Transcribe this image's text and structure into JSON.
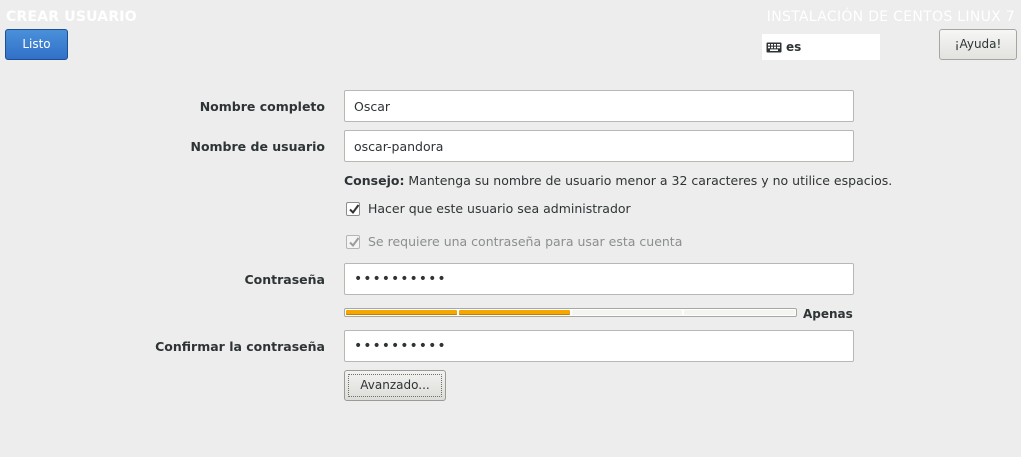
{
  "header": {
    "title": "CREAR USUARIO",
    "install_title": "INSTALACIÓN DE CENTOS LINUX 7",
    "done_label": "Listo",
    "help_label": "¡Ayuda!",
    "keyboard_layout": "es",
    "keyboard_icon": "keyboard-icon"
  },
  "form": {
    "fullname": {
      "label": "Nombre completo",
      "value": "Oscar"
    },
    "username": {
      "label": "Nombre de usuario",
      "value": "oscar-pandora"
    },
    "hint": {
      "prefix": "Consejo:",
      "text": " Mantenga su nombre de usuario menor a 32 caracteres y no utilice espacios."
    },
    "admin_checkbox": {
      "label": "Hacer que este usuario sea administrador",
      "checked": true
    },
    "require_password_checkbox": {
      "label": "Se requiere una contraseña para usar esta cuenta",
      "checked": true,
      "disabled": true
    },
    "password": {
      "label": "Contraseña",
      "value": "••••••••••"
    },
    "strength": {
      "label": "Apenas",
      "filled_segments": 2,
      "total_segments": 4,
      "color": "#f5a600"
    },
    "confirm": {
      "label": "Confirmar la contraseña",
      "value": "••••••••••"
    },
    "advanced_label": "Avanzado..."
  }
}
